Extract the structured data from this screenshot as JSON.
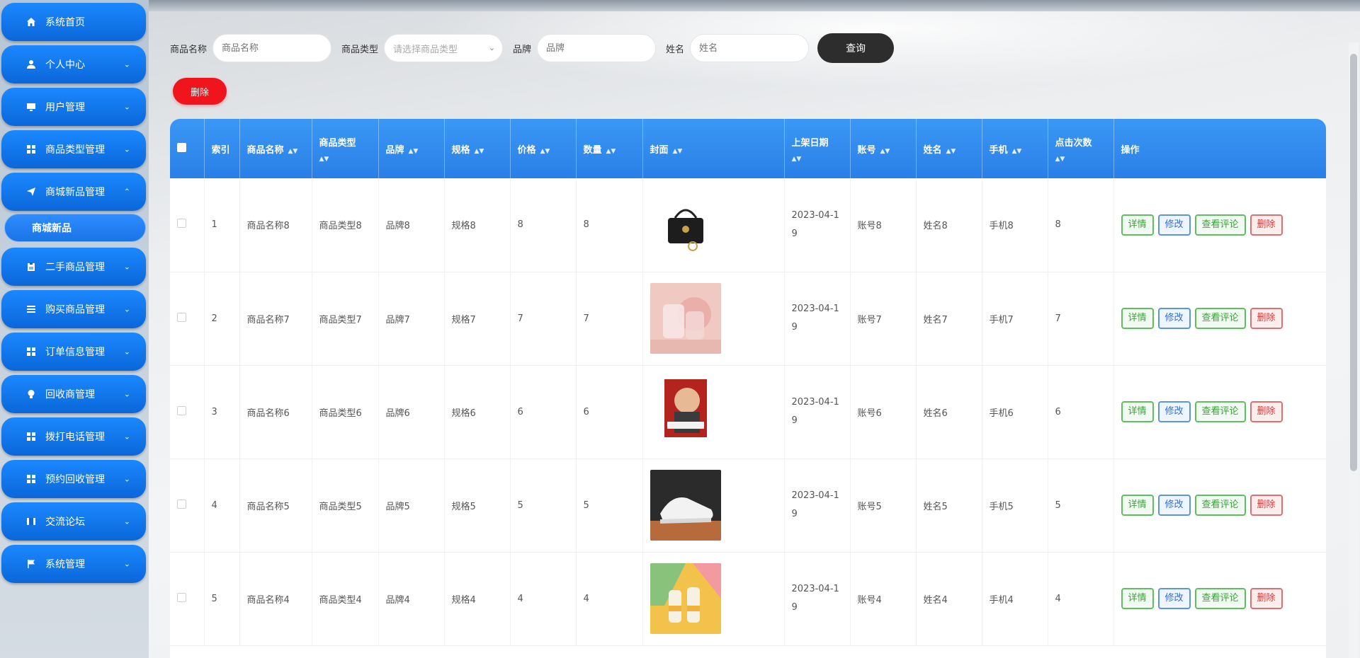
{
  "sidebar": {
    "items": [
      {
        "label": "系统首页",
        "icon": "home-icon",
        "arrow": ""
      },
      {
        "label": "个人中心",
        "icon": "user-icon",
        "arrow": "⌄"
      },
      {
        "label": "用户管理",
        "icon": "monitor-icon",
        "arrow": "⌄"
      },
      {
        "label": "商品类型管理",
        "icon": "grid-icon",
        "arrow": "⌄"
      },
      {
        "label": "商城新品管理",
        "icon": "send-icon",
        "arrow": "⌃"
      },
      {
        "label": "二手商品管理",
        "icon": "clipboard-icon",
        "arrow": "⌄"
      },
      {
        "label": "购买商品管理",
        "icon": "list-icon",
        "arrow": "⌄"
      },
      {
        "label": "订单信息管理",
        "icon": "grid-icon",
        "arrow": "⌄"
      },
      {
        "label": "回收商管理",
        "icon": "bulb-icon",
        "arrow": "⌄"
      },
      {
        "label": "拨打电话管理",
        "icon": "grid-icon",
        "arrow": "⌄"
      },
      {
        "label": "预约回收管理",
        "icon": "grid-icon",
        "arrow": "⌄"
      },
      {
        "label": "交流论坛",
        "icon": "film-icon",
        "arrow": "⌄"
      },
      {
        "label": "系统管理",
        "icon": "flag-icon",
        "arrow": "⌄"
      }
    ],
    "submenu": {
      "label": "商城新品"
    }
  },
  "search": {
    "name_label": "商品名称",
    "name_placeholder": "商品名称",
    "type_label": "商品类型",
    "type_placeholder": "请选择商品类型",
    "brand_label": "品牌",
    "brand_placeholder": "品牌",
    "person_label": "姓名",
    "person_placeholder": "姓名",
    "query_label": "查询"
  },
  "toolbar": {
    "delete_label": "删除"
  },
  "table": {
    "headers": {
      "index": "索引",
      "name": "商品名称",
      "type": "商品类型",
      "brand": "品牌",
      "spec": "规格",
      "price": "价格",
      "qty": "数量",
      "cover": "封面",
      "date": "上架日期",
      "account": "账号",
      "person": "姓名",
      "phone": "手机",
      "clicks": "点击次数",
      "ops": "操作"
    },
    "ops": {
      "detail": "详情",
      "edit": "修改",
      "review": "查看评论",
      "delete": "删除"
    },
    "rows": [
      {
        "index": "1",
        "name": "商品名称8",
        "type": "商品类型8",
        "brand": "品牌8",
        "spec": "规格8",
        "price": "8",
        "qty": "8",
        "date_a": "2023-04-1",
        "date_b": "9",
        "account": "账号8",
        "person": "姓名8",
        "phone": "手机8",
        "clicks": "8"
      },
      {
        "index": "2",
        "name": "商品名称7",
        "type": "商品类型7",
        "brand": "品牌7",
        "spec": "规格7",
        "price": "7",
        "qty": "7",
        "date_a": "2023-04-1",
        "date_b": "9",
        "account": "账号7",
        "person": "姓名7",
        "phone": "手机7",
        "clicks": "7"
      },
      {
        "index": "3",
        "name": "商品名称6",
        "type": "商品类型6",
        "brand": "品牌6",
        "spec": "规格6",
        "price": "6",
        "qty": "6",
        "date_a": "2023-04-1",
        "date_b": "9",
        "account": "账号6",
        "person": "姓名6",
        "phone": "手机6",
        "clicks": "6"
      },
      {
        "index": "4",
        "name": "商品名称5",
        "type": "商品类型5",
        "brand": "品牌5",
        "spec": "规格5",
        "price": "5",
        "qty": "5",
        "date_a": "2023-04-1",
        "date_b": "9",
        "account": "账号5",
        "person": "姓名5",
        "phone": "手机5",
        "clicks": "5"
      },
      {
        "index": "5",
        "name": "商品名称4",
        "type": "商品类型4",
        "brand": "品牌4",
        "spec": "规格4",
        "price": "4",
        "qty": "4",
        "date_a": "2023-04-1",
        "date_b": "9",
        "account": "账号4",
        "person": "姓名4",
        "phone": "手机4",
        "clicks": "4"
      }
    ]
  },
  "colors": {
    "sidebar_blue": "#0a67d9",
    "header_blue": "#2a7fe6",
    "delete_red": "#f0141d",
    "query_dark": "#2d2d2d"
  }
}
